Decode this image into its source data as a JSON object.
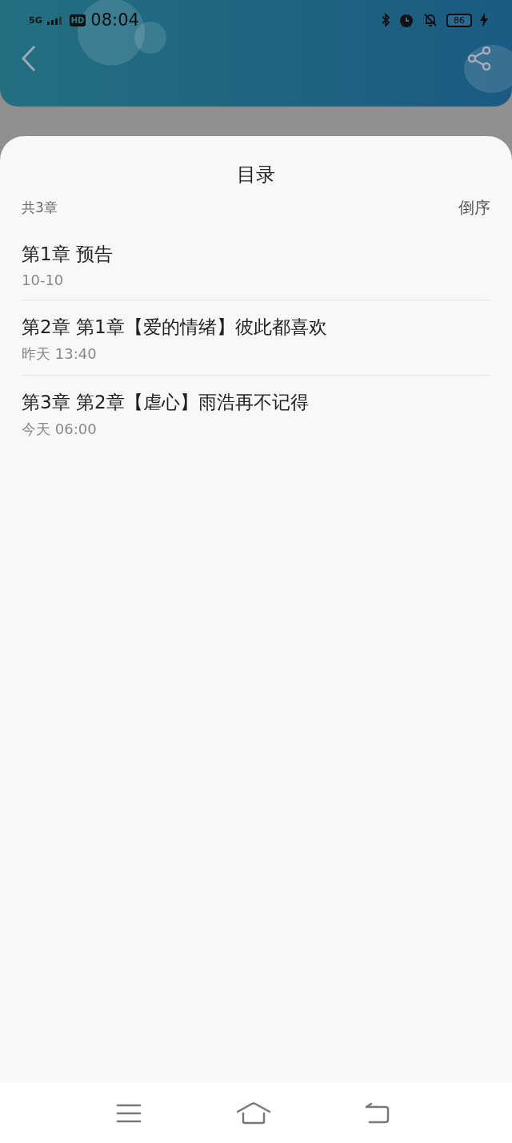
{
  "status_bar": {
    "network": "5G",
    "hd": "HD",
    "time": "08:04",
    "battery": "86"
  },
  "sheet": {
    "title": "目录",
    "count": "共3章",
    "sort": "倒序"
  },
  "chapters": [
    {
      "title": "第1章 预告",
      "time": "10-10"
    },
    {
      "title": "第2章 第1章【爱的情绪】彼此都喜欢",
      "time": "昨天 13:40"
    },
    {
      "title": "第3章 第2章【虐心】雨浩再不记得",
      "time": "今天 06:00"
    }
  ]
}
